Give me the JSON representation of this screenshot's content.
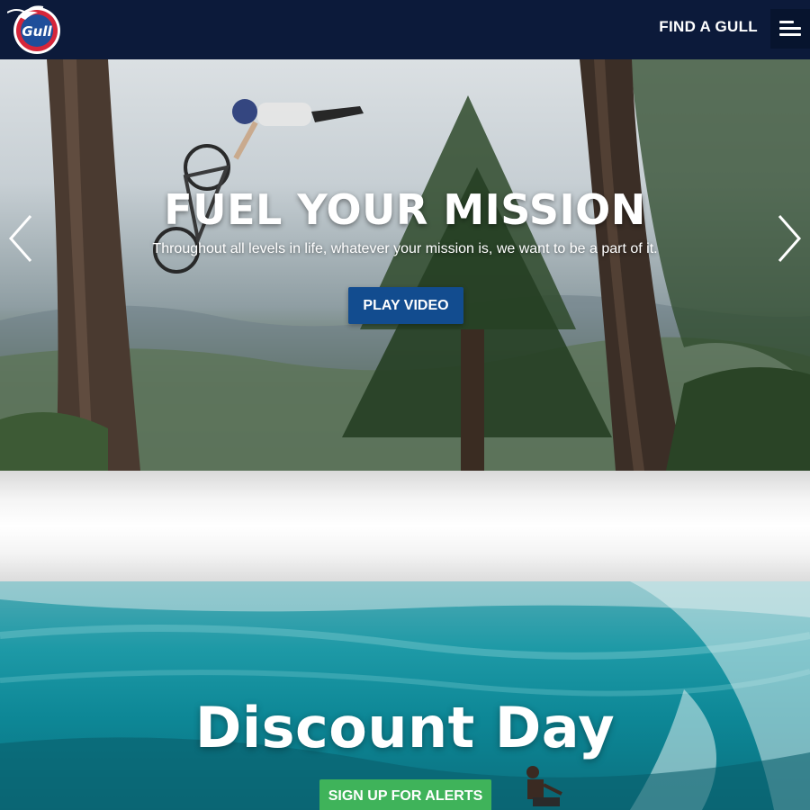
{
  "header": {
    "logo_text": "Gull",
    "find_label": "FIND A GULL",
    "menu_icon": "hamburger-menu-icon"
  },
  "hero": {
    "title": "FUEL YOUR MISSION",
    "subtitle": "Throughout all levels in life, whatever your mission is, we want to be a part of it.",
    "play_label": "PLAY VIDEO",
    "prev_icon": "chevron-left-icon",
    "next_icon": "chevron-right-icon"
  },
  "promo": {
    "title": "Discount Day",
    "signup_label": "SIGN UP FOR ALERTS"
  },
  "colors": {
    "header_bg": "#0c1a3a",
    "play_button": "#124c8f",
    "signup_button": "#3fb35a"
  }
}
